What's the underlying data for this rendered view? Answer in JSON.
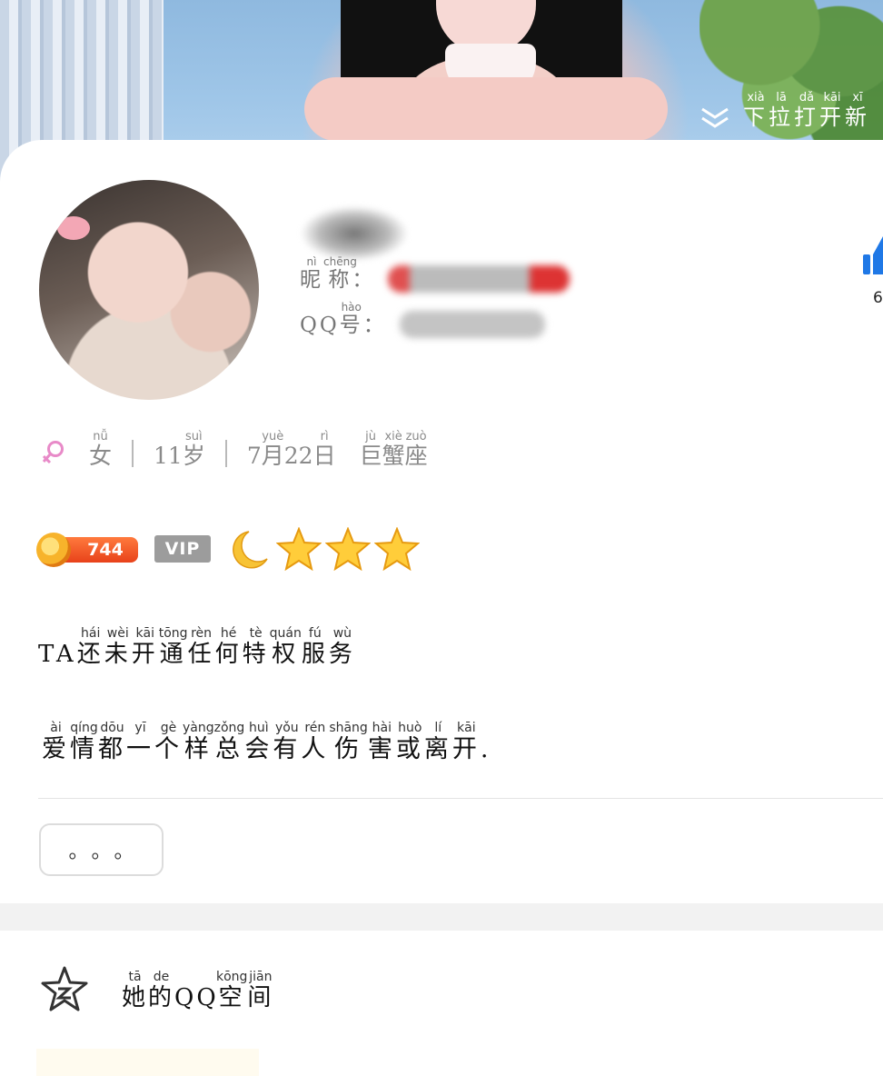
{
  "header": {
    "pull_hint": [
      "下",
      "拉",
      "打",
      "开",
      "新"
    ],
    "pull_hint_pinyin": [
      "xià",
      "lā",
      "dǎ",
      "kāi",
      "xī"
    ]
  },
  "profile": {
    "nickname_label": [
      "昵",
      "称"
    ],
    "nickname_label_pinyin": [
      "nì",
      "chēng"
    ],
    "nickname_colon": "：",
    "qq_label_prefix": "QQ",
    "qq_label_char": "号",
    "qq_label_pinyin": "hào",
    "qq_colon": "：",
    "like_count": "6"
  },
  "info": {
    "gender": "女",
    "gender_pinyin": "nǚ",
    "age_num": "11",
    "age_unit": "岁",
    "age_unit_pinyin": "suì",
    "birthday_month": "7",
    "birthday_month_char": "月",
    "birthday_month_pinyin": "yuè",
    "birthday_day": "22",
    "birthday_day_char": "日",
    "birthday_day_pinyin": "rì",
    "zodiac": [
      "巨",
      "蟹",
      "座"
    ],
    "zodiac_pinyin": [
      "jù",
      "xiè",
      "zuò"
    ]
  },
  "badges": {
    "level": "744",
    "vip": "VIP",
    "moon_count": 1,
    "star_count": 3
  },
  "privilege": {
    "prefix": "TA",
    "chars": [
      "还",
      "未",
      "开",
      "通",
      "任",
      "何",
      "特",
      "权",
      "服",
      "务"
    ],
    "pinyin": [
      "hái",
      "wèi",
      "kāi",
      "tōng",
      "rèn",
      "hé",
      "tè",
      "quán",
      "fú",
      "wù"
    ]
  },
  "signature": {
    "chars": [
      "爱",
      "情",
      "都",
      "一",
      "个",
      "样",
      "总",
      "会",
      "有",
      "人",
      "伤",
      "害",
      "或",
      "离",
      "开"
    ],
    "pinyin": [
      "ài",
      "qíng",
      "dōu",
      "yī",
      "gè",
      "yàng",
      "zǒng",
      "huì",
      "yǒu",
      "rén",
      "shāng",
      "hài",
      "huò",
      "lí",
      "kāi"
    ],
    "end": "."
  },
  "more_button": {
    "label": "。。。"
  },
  "qzone": {
    "chars": [
      "她",
      "的"
    ],
    "pinyin": [
      "tā",
      "de"
    ],
    "middle": "QQ",
    "chars2": [
      "空",
      "间"
    ],
    "pinyin2": [
      "kōng",
      "jiān"
    ]
  },
  "colors": {
    "accent_blue": "#1f78e6",
    "level_orange": "#e8421a",
    "vip_gray": "#9c9c9c",
    "female_pink": "#e88ac8"
  }
}
